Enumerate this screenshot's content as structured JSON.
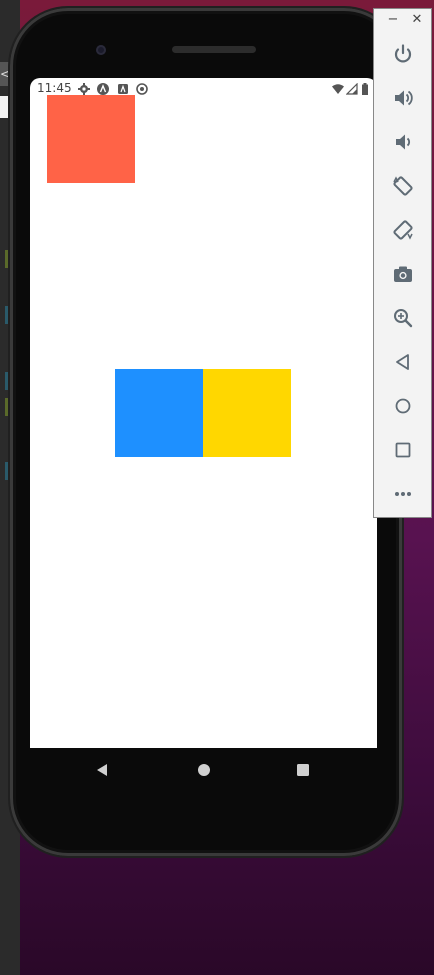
{
  "status_bar": {
    "time": "11:45",
    "left_icons": [
      "gear-icon",
      "vpn-app-icon",
      "app-icon",
      "sync-icon"
    ],
    "right_icons": [
      "wifi-icon",
      "signal-icon",
      "battery-icon"
    ]
  },
  "app": {
    "boxes": [
      {
        "name": "tomato-box",
        "color": "#FF6347"
      },
      {
        "name": "blue-box",
        "color": "#1E90FF"
      },
      {
        "name": "gold-box",
        "color": "#FFD700"
      }
    ]
  },
  "nav_bar": {
    "buttons": [
      "back-icon",
      "home-icon",
      "recents-icon"
    ]
  },
  "emulator_toolbar": {
    "window_controls": {
      "minimize": "−",
      "close": "✕"
    },
    "buttons": [
      "power-icon",
      "volume-up-icon",
      "volume-down-icon",
      "rotate-left-icon",
      "rotate-right-icon",
      "screenshot-icon",
      "zoom-icon",
      "back-icon",
      "home-icon",
      "overview-icon",
      "more-icon"
    ]
  },
  "desktop": {
    "left_edge_glyph": "<"
  }
}
